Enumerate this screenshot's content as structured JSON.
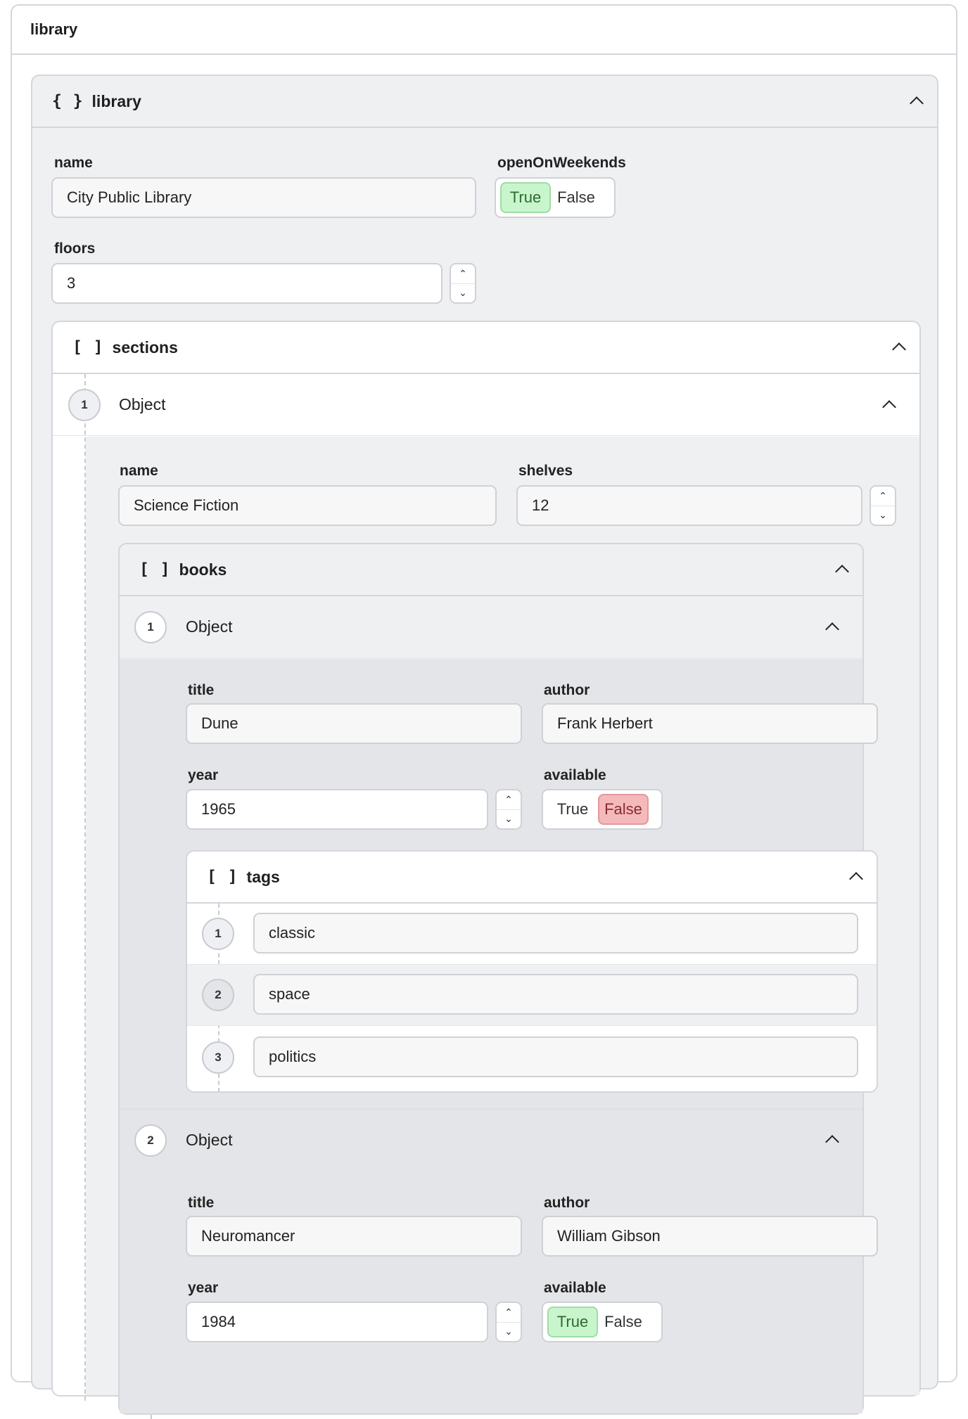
{
  "window": {
    "title": "library"
  },
  "library": {
    "symbol": "{ }",
    "title": "library",
    "fields": {
      "name": {
        "label": "name",
        "value": "City Public Library"
      },
      "openOnWeekends": {
        "label": "openOnWeekends",
        "true_label": "True",
        "false_label": "False",
        "value": true
      },
      "floors": {
        "label": "floors",
        "value": "3"
      }
    },
    "sections": {
      "symbol": "[ ]",
      "title": "sections",
      "items": [
        {
          "index": "1",
          "type_label": "Object",
          "name": {
            "label": "name",
            "value": "Science Fiction"
          },
          "shelves": {
            "label": "shelves",
            "value": "12"
          },
          "books": {
            "symbol": "[ ]",
            "title": "books",
            "items": [
              {
                "index": "1",
                "type_label": "Object",
                "title": {
                  "label": "title",
                  "value": "Dune"
                },
                "author": {
                  "label": "author",
                  "value": "Frank Herbert"
                },
                "year": {
                  "label": "year",
                  "value": "1965"
                },
                "available": {
                  "label": "available",
                  "true_label": "True",
                  "false_label": "False",
                  "value": false
                },
                "tags": {
                  "symbol": "[ ]",
                  "title": "tags",
                  "items": [
                    {
                      "index": "1",
                      "value": "classic"
                    },
                    {
                      "index": "2",
                      "value": "space"
                    },
                    {
                      "index": "3",
                      "value": "politics"
                    }
                  ]
                }
              },
              {
                "index": "2",
                "type_label": "Object",
                "title": {
                  "label": "title",
                  "value": "Neuromancer"
                },
                "author": {
                  "label": "author",
                  "value": "William Gibson"
                },
                "year": {
                  "label": "year",
                  "value": "1984"
                },
                "available": {
                  "label": "available",
                  "true_label": "True",
                  "false_label": "False",
                  "value": true
                }
              }
            ]
          }
        }
      ]
    }
  },
  "icons": {
    "collapse": "chevron-up-icon",
    "increment": "caret-up-icon",
    "decrement": "caret-down-icon"
  },
  "colors": {
    "true_active": "#c9f5cd",
    "false_active": "#f4b9bb",
    "panel_bg": "#eff0f2",
    "nested_bg": "#e4e5e8"
  }
}
